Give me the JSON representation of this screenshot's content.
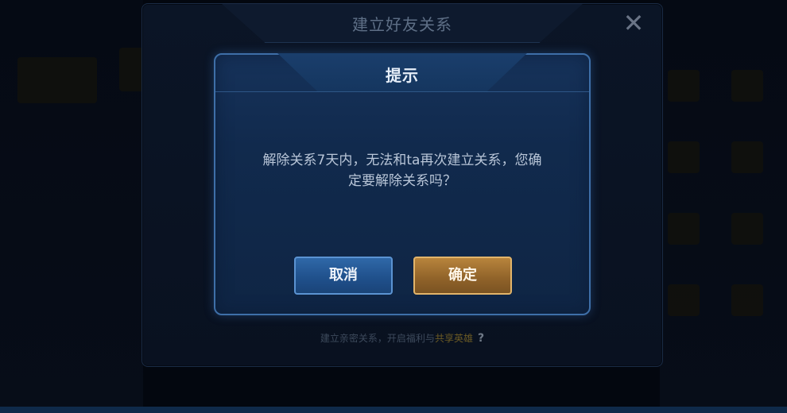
{
  "background_window": {
    "title": "建立好友关系",
    "close_icon": "close-icon",
    "footer_text_prefix": "建立亲密关系，开启福利与",
    "footer_text_highlight": "共享英雄",
    "help_icon": "?"
  },
  "dialog": {
    "title": "提示",
    "message_line1": "解除关系7天内，无法和ta再次建立关系，您确",
    "message_line2": "定要解除关系吗？",
    "cancel_label": "取消",
    "confirm_label": "确定"
  },
  "colors": {
    "dialog_border": "#3e6fa8",
    "cancel_button": "#2f68a8",
    "confirm_button": "#b8843c"
  }
}
